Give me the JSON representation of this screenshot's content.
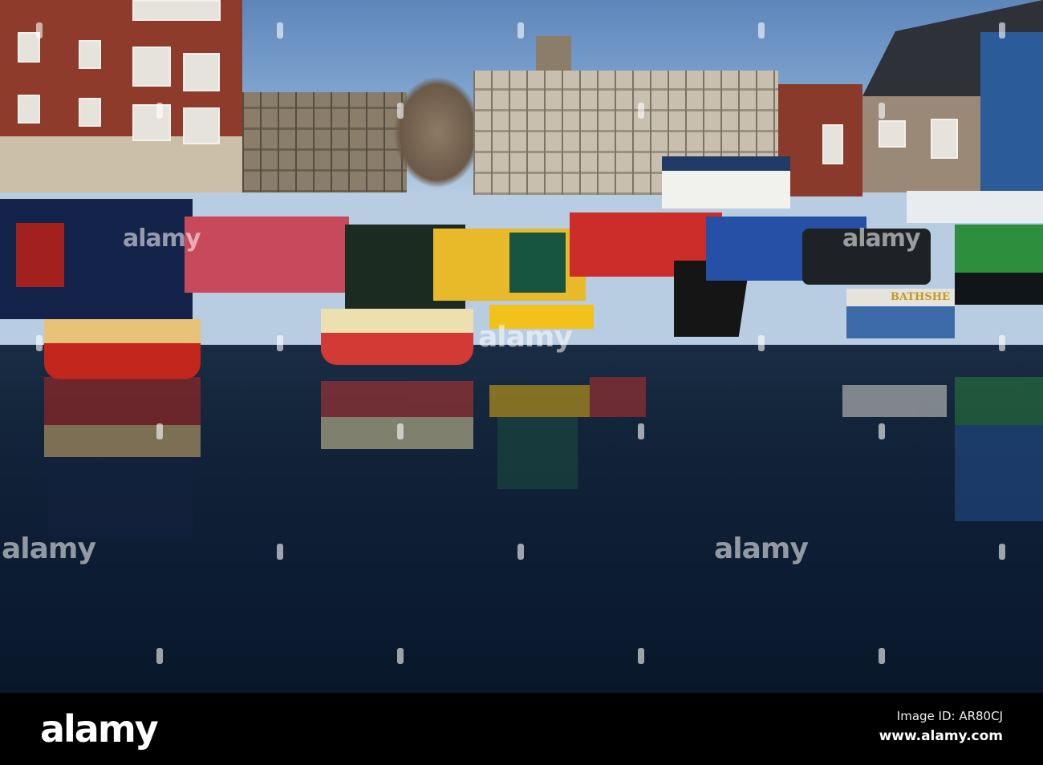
{
  "photo": {
    "boat_name": "BATHSHE",
    "watermark": "alamy"
  },
  "footer": {
    "logo": "alamy",
    "image_id": "Image ID: AR80CJ",
    "website": "www.alamy.com"
  },
  "colors": {
    "sky": "#8fb1d6",
    "water": "#12243a",
    "brick": "#8a3a2a"
  }
}
